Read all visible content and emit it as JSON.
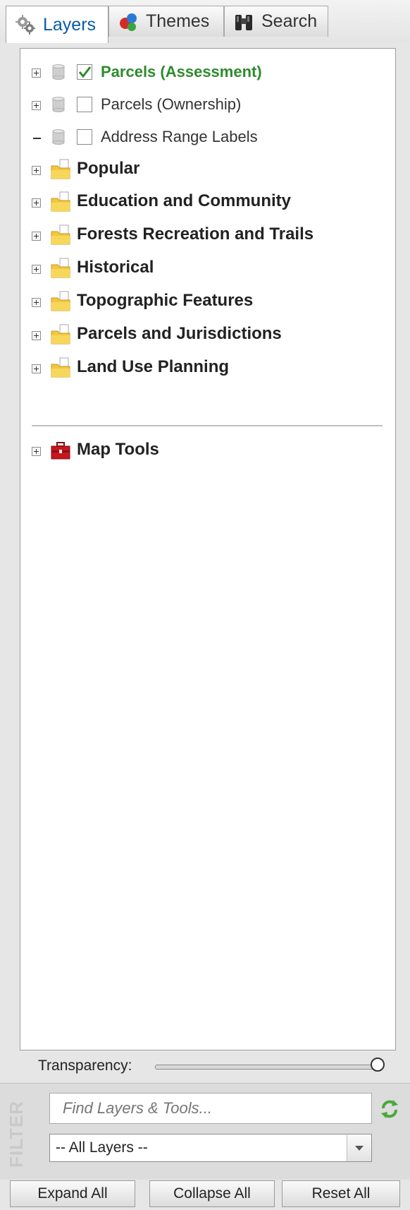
{
  "tabs": [
    {
      "label": "Layers",
      "icon": "gears-icon",
      "active": true
    },
    {
      "label": "Themes",
      "icon": "themes-balls-icon",
      "active": false
    },
    {
      "label": "Search",
      "icon": "binoculars-icon",
      "active": false
    }
  ],
  "tree": {
    "layers": [
      {
        "label": "Parcels (Assessment)",
        "checked": true,
        "expander": "plus"
      },
      {
        "label": "Parcels (Ownership)",
        "checked": false,
        "expander": "plus"
      },
      {
        "label": "Address Range Labels",
        "checked": false,
        "expander": "dash"
      }
    ],
    "groups": [
      {
        "label": "Popular"
      },
      {
        "label": "Education and Community"
      },
      {
        "label": "Forests Recreation and Trails"
      },
      {
        "label": "Historical"
      },
      {
        "label": "Topographic Features"
      },
      {
        "label": "Parcels and Jurisdictions"
      },
      {
        "label": "Land Use Planning"
      }
    ],
    "tools": {
      "label": "Map Tools",
      "icon": "toolbox-icon"
    }
  },
  "transparency": {
    "label": "Transparency:",
    "value_percent": 100
  },
  "filter": {
    "vertical_label": "FILTER",
    "search_placeholder": "Find Layers & Tools...",
    "select_value": "-- All Layers --"
  },
  "buttons": {
    "expand_all": "Expand All",
    "collapse_all": "Collapse All",
    "reset_all": "Reset All"
  },
  "colors": {
    "active_tab_text": "#0b5aa8",
    "checked_layer_text": "#2e8b2e",
    "folder_yellow": "#f2c73f",
    "toolbox_red": "#c8161d",
    "refresh_green": "#4aa83a"
  }
}
